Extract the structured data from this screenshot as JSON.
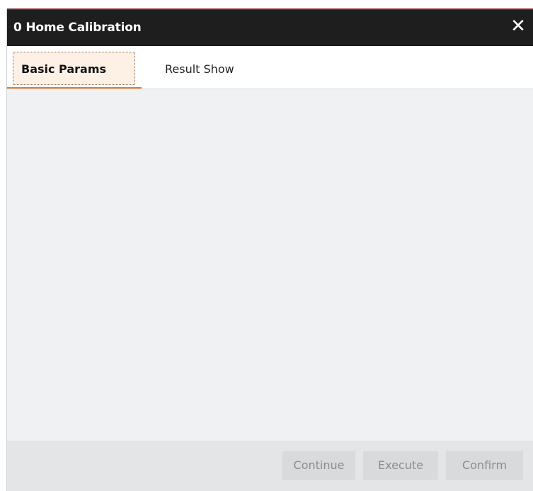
{
  "dialog": {
    "title": "0 Home Calibration",
    "close_glyph": "✕"
  },
  "tabs": [
    {
      "label": "Basic Params",
      "active": true
    },
    {
      "label": "Result Show",
      "active": false
    }
  ],
  "footer": {
    "continue_label": "Continue",
    "execute_label": "Execute",
    "confirm_label": "Confirm"
  },
  "colors": {
    "titlebar": "#1e1e1e",
    "titlebar_accent": "#8a2020",
    "active_tab_underline": "#e07b2e",
    "active_tab_bg": "#fdf1e6",
    "content_bg": "#f0f1f3",
    "disabled_text": "#8c8c8c"
  }
}
